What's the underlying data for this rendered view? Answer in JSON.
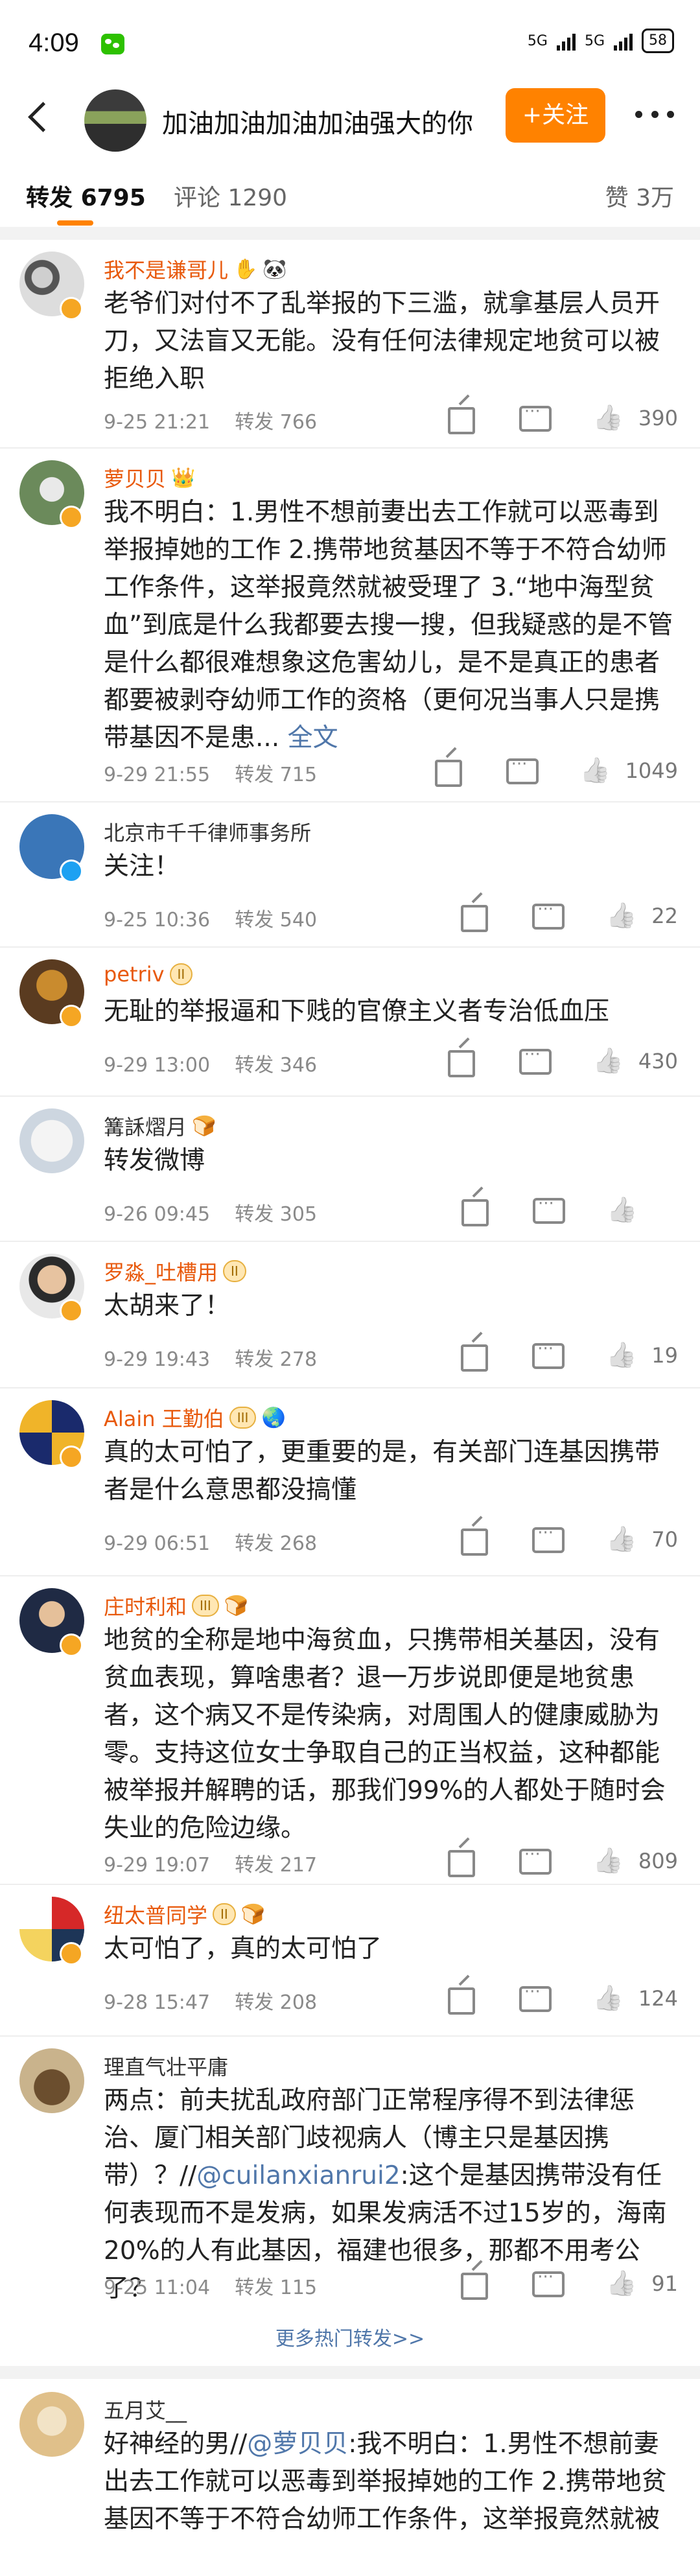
{
  "status_bar": {
    "time": "4:09",
    "network": "5G",
    "battery": "58"
  },
  "header": {
    "title": "加油加油加油加油强大的你",
    "follow_label": "+关注"
  },
  "tabs": [
    {
      "label": "转发",
      "count": "6795"
    },
    {
      "label": "评论",
      "count": "1290"
    },
    {
      "label": "赞",
      "count": "3万"
    }
  ],
  "colors": {
    "accent": "#ff8200",
    "link": "#5077aa",
    "orange_name": "#e8590c"
  },
  "comments": [
    {
      "name": "我不是谦哥儿",
      "badges": [
        "✋",
        "🐼"
      ],
      "text": "老爷们对付不了乱举报的下三滥，就拿基层人员开刀，又法盲又无能。没有任何法律规定地贫可以被拒绝入职",
      "time": "9-25 21:21",
      "repost": "转发 766",
      "likes": "390"
    },
    {
      "name": "萝贝贝",
      "badges": [
        "👑"
      ],
      "text": "我不明白：1.男性不想前妻出去工作就可以恶毒到举报掉她的工作 2.携带地贫基因不等于不符合幼师工作条件，这举报竟然就被受理了 3.“地中海型贫血”到底是什么我都要去搜一搜，但我疑惑的是不管是什么都很难想象这危害幼儿，是不是真正的患者都要被剥夺幼师工作的资格（更何况当事人只是携带基因不是患...",
      "full_label": "全文",
      "time": "9-29 21:55",
      "repost": "转发 715",
      "likes": "1049"
    },
    {
      "name": "北京市千千律师事务所",
      "badges": [],
      "text": "关注！",
      "time": "9-25 10:36",
      "repost": "转发 540",
      "likes": "22"
    },
    {
      "name": "petriv",
      "badges": [
        "II"
      ],
      "text": "无耻的举报逼和下贱的官僚主义者专治低血压",
      "time": "9-29 13:00",
      "repost": "转发 346",
      "likes": "430"
    },
    {
      "name": "篝訸熠月",
      "badges": [
        "🍞"
      ],
      "text": "转发微博",
      "time": "9-26 09:45",
      "repost": "转发 305",
      "likes": ""
    },
    {
      "name": "罗淼_吐槽用",
      "badges": [
        "II"
      ],
      "text": "太胡来了！",
      "time": "9-29 19:43",
      "repost": "转发 278",
      "likes": "19"
    },
    {
      "name": "Alain 王勤伯",
      "badges": [
        "III",
        "🌏"
      ],
      "text": "真的太可怕了，更重要的是，有关部门连基因携带者是什么意思都没搞懂",
      "time": "9-29 06:51",
      "repost": "转发 268",
      "likes": "70"
    },
    {
      "name": "庄时利和",
      "badges": [
        "III",
        "🍞"
      ],
      "text": "地贫的全称是地中海贫血，只携带相关基因，没有贫血表现，算啥患者？退一万步说即便是地贫患者，这个病又不是传染病，对周围人的健康威胁为零。支持这位女士争取自己的正当权益，这种都能被举报并解聘的话，那我们99%的人都处于随时会失业的危险边缘。",
      "time": "9-29 19:07",
      "repost": "转发 217",
      "likes": "809"
    },
    {
      "name": "纽太普同学",
      "badges": [
        "II",
        "🍞"
      ],
      "text": "太可怕了，真的太可怕了",
      "time": "9-28 15:47",
      "repost": "转发 208",
      "likes": "124"
    },
    {
      "name": "理直气壮平庸",
      "badges": [],
      "text_before": "两点：前夫扰乱政府部门正常程序得不到法律惩治、厦门相关部门歧视病人（博主只是基因携带）？//",
      "mention": "@cuilanxianrui2",
      "text_after": ":这个是基因携带没有任何表现而不是发病，如果发病活不过15岁的，海南20%的人有此基因，福建也很多，那都不用考公了？",
      "time": "9-25 11:04",
      "repost": "转发 115",
      "likes": "91"
    }
  ],
  "more_hot_label": "更多热门转发>>",
  "last_comment": {
    "name": "五月艾__",
    "mention": "@萝贝贝",
    "text_before": "好神经的男//",
    "text_after": ":我不明白：1.男性不想前妻出去工作就可以恶毒到举报掉她的工作 2.携带地贫基因不等于不符合幼师工作条件，这举报竟然就被"
  }
}
